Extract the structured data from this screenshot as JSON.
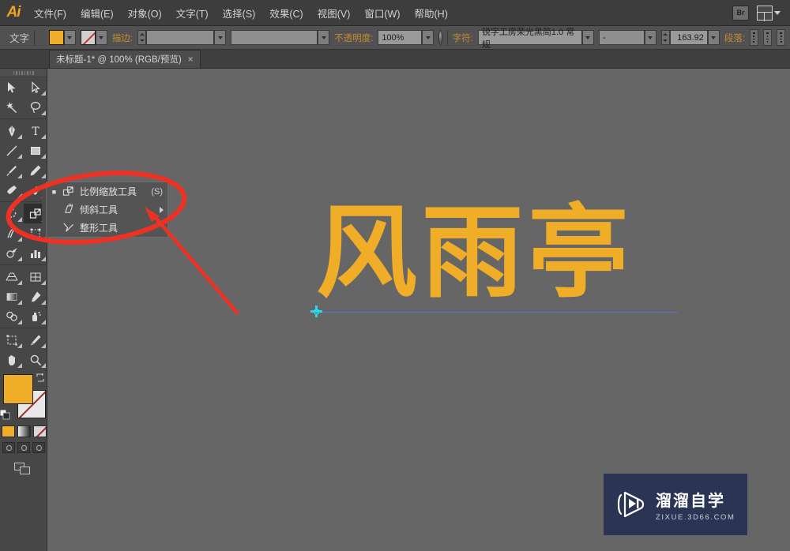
{
  "app": {
    "logo": "Ai",
    "menus": [
      {
        "label": "文件(F)",
        "name": "menu-file"
      },
      {
        "label": "编辑(E)",
        "name": "menu-edit"
      },
      {
        "label": "对象(O)",
        "name": "menu-object"
      },
      {
        "label": "文字(T)",
        "name": "menu-type"
      },
      {
        "label": "选择(S)",
        "name": "menu-select"
      },
      {
        "label": "效果(C)",
        "name": "menu-effect"
      },
      {
        "label": "视图(V)",
        "name": "menu-view"
      },
      {
        "label": "窗口(W)",
        "name": "menu-window"
      },
      {
        "label": "帮助(H)",
        "name": "menu-help"
      }
    ],
    "bridge_label": "Br"
  },
  "control_bar": {
    "context_label": "文字",
    "fill_color": "#f0ad28",
    "stroke_label": "描边:",
    "stroke_weight": "",
    "stroke_profile": "",
    "opacity_label": "不透明度:",
    "opacity_value": "100%",
    "char_label": "字符:",
    "font_family": "锐字工房荣光黑简1.0 常规",
    "font_style": "-",
    "font_size": "163.92",
    "para_label": "段落:",
    "align_left": "左对齐",
    "align_center": "居中对齐",
    "align_right": "右对齐"
  },
  "document": {
    "tab_title": "未标题-1* @ 100% (RGB/预览)",
    "close_glyph": "×"
  },
  "canvas": {
    "artwork_text": "风雨亭",
    "artwork_color": "#f0ad28",
    "background_color": "#666666",
    "baseline_color": "#5b74c8",
    "anchor_color": "#2fd6e6"
  },
  "toolbar": {
    "tools": [
      {
        "name": "selection-tool",
        "icon": "arrow-solid"
      },
      {
        "name": "direct-selection-tool",
        "icon": "arrow-outline"
      },
      {
        "name": "magic-wand-tool",
        "icon": "wand"
      },
      {
        "name": "lasso-tool",
        "icon": "lasso"
      },
      {
        "name": "pen-tool",
        "icon": "pen"
      },
      {
        "name": "type-tool",
        "icon": "type-T"
      },
      {
        "name": "line-segment-tool",
        "icon": "line"
      },
      {
        "name": "rectangle-tool",
        "icon": "rectangle"
      },
      {
        "name": "paintbrush-tool",
        "icon": "brush"
      },
      {
        "name": "pencil-tool",
        "icon": "pencil"
      },
      {
        "name": "blob-brush-tool",
        "icon": "blob"
      },
      {
        "name": "eraser-tool",
        "icon": "eraser"
      },
      {
        "name": "rotate-tool",
        "icon": "rotate"
      },
      {
        "name": "scale-tool",
        "icon": "scale",
        "active": true
      },
      {
        "name": "width-tool",
        "icon": "width"
      },
      {
        "name": "free-transform-tool",
        "icon": "free-transform"
      },
      {
        "name": "shape-builder-tool",
        "icon": "shape-builder"
      },
      {
        "name": "perspective-grid-tool",
        "icon": "perspective"
      },
      {
        "name": "mesh-tool",
        "icon": "mesh"
      },
      {
        "name": "gradient-tool",
        "icon": "gradient"
      },
      {
        "name": "eyedropper-tool",
        "icon": "eyedropper"
      },
      {
        "name": "blend-tool",
        "icon": "blend"
      },
      {
        "name": "symbol-sprayer-tool",
        "icon": "sprayer"
      },
      {
        "name": "column-graph-tool",
        "icon": "bar-graph"
      },
      {
        "name": "artboard-tool",
        "icon": "artboard"
      },
      {
        "name": "slice-tool",
        "icon": "slice"
      },
      {
        "name": "hand-tool",
        "icon": "hand"
      },
      {
        "name": "zoom-tool",
        "icon": "magnifier"
      }
    ],
    "fill_color": "#f0ad28",
    "stroke_color": "none",
    "color_modes": [
      "color",
      "gradient",
      "none"
    ],
    "draw_modes": [
      "draw-normal",
      "draw-behind",
      "draw-inside"
    ],
    "screen_mode": "change-screen-mode"
  },
  "flyout_menu": {
    "items": [
      {
        "label": "比例缩放工具",
        "shortcut": "(S)",
        "icon": "scale",
        "selected": true,
        "submenu": false
      },
      {
        "label": "倾斜工具",
        "shortcut": "",
        "icon": "shear",
        "selected": false,
        "submenu": true
      },
      {
        "label": "整形工具",
        "shortcut": "",
        "icon": "reshape",
        "selected": false,
        "submenu": false
      }
    ]
  },
  "annotations": {
    "ellipse_color": "#ef3124",
    "arrow_color": "#ef3124"
  },
  "watermark": {
    "brand_cn": "溜溜自学",
    "brand_url": "ZIXUE.3D66.COM",
    "background": "#2b3553"
  }
}
